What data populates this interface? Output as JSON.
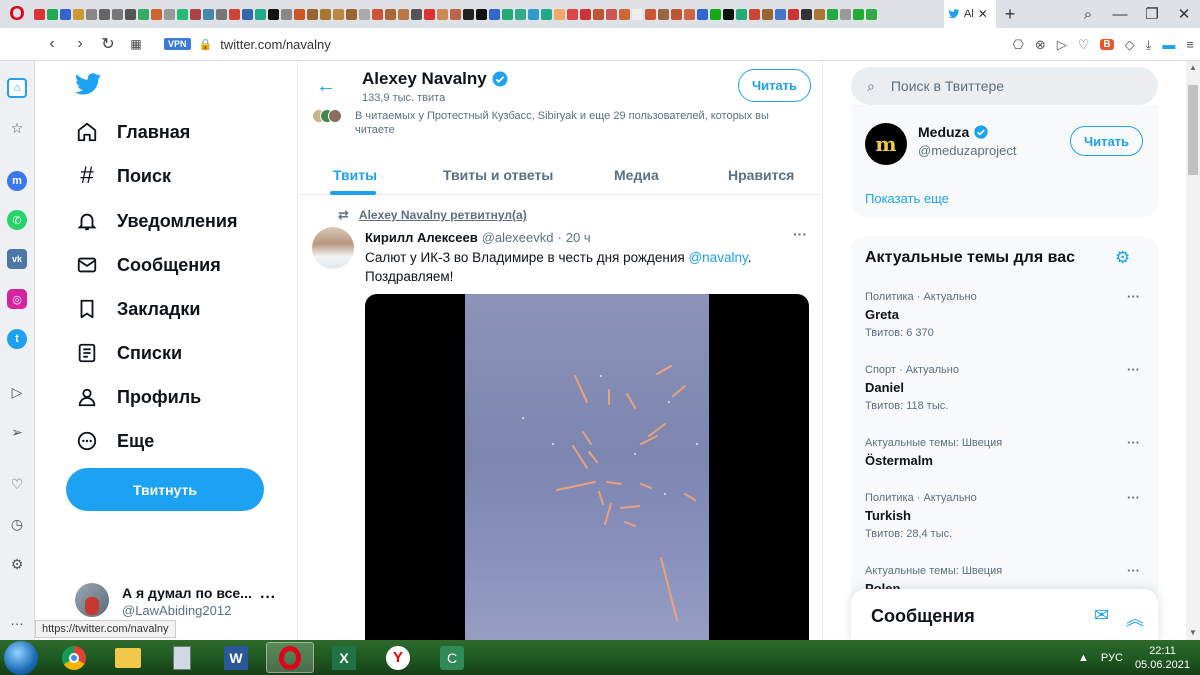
{
  "browser": {
    "active_tab_title": "Al",
    "url": "twitter.com/navalny",
    "vpn_label": "VPN",
    "status_url": "https://twitter.com/navalny"
  },
  "nav": {
    "items": [
      {
        "label": "Главная",
        "icon": "home-icon"
      },
      {
        "label": "Поиск",
        "icon": "hashtag-icon"
      },
      {
        "label": "Уведомления",
        "icon": "bell-icon"
      },
      {
        "label": "Сообщения",
        "icon": "mail-icon"
      },
      {
        "label": "Закладки",
        "icon": "bookmark-icon"
      },
      {
        "label": "Списки",
        "icon": "list-icon"
      },
      {
        "label": "Профиль",
        "icon": "person-icon"
      },
      {
        "label": "Еще",
        "icon": "more-circle-icon"
      }
    ],
    "tweet_button": "Твитнуть",
    "account": {
      "name": "А я думал по все...",
      "handle": "@LawAbiding2012"
    }
  },
  "profile": {
    "name": "Alexey Navalny",
    "tweet_count": "133,9 тыс. твита",
    "follow_label": "Читать",
    "followers_text": "В читаемых у Протестный Кузбасс, Sibiryak и еще 29 пользователей, которых вы читаете",
    "tabs": [
      "Твиты",
      "Твиты и ответы",
      "Медиа",
      "Нравится"
    ]
  },
  "tweet": {
    "retweet_label": "Alexey Navalny ретвитнул(а)",
    "author_name": "Кирилл Алексеев",
    "author_handle": "@alexeevkd",
    "separator": "·",
    "time": "20 ч",
    "text_before": "Салют у ИК-3 во Владимире в честь дня рождения ",
    "mention": "@navalny",
    "text_after": ". Поздравляем!"
  },
  "sidebar": {
    "search_placeholder": "Поиск в Твиттере",
    "suggested": {
      "name": "Meduza",
      "handle": "@meduzaproject",
      "follow_label": "Читать",
      "avatar_letter": "m"
    },
    "show_more": "Показать еще",
    "trends_title": "Актуальные темы для вас",
    "trends": [
      {
        "category": "Политика · Актуально",
        "name": "Greta",
        "count": "Твитов: 6 370"
      },
      {
        "category": "Спорт · Актуально",
        "name": "Daniel",
        "count": "Твитов: 118 тыс."
      },
      {
        "category": "Актуальные темы: Швеция",
        "name": "Östermalm",
        "count": ""
      },
      {
        "category": "Политика · Актуально",
        "name": "Turkish",
        "count": "Твитов: 28,4 тыс."
      },
      {
        "category": "Актуальные темы: Швеция",
        "name": "Polen",
        "count": ""
      }
    ],
    "messages_title": "Сообщения"
  },
  "taskbar": {
    "lang": "РУС",
    "time": "22:11",
    "date": "05.06.2021"
  },
  "colors": {
    "twitter_blue": "#1da1f2",
    "text_primary": "#0f1419",
    "text_secondary": "#5b7083",
    "taskbar_green": "#1f5a23"
  }
}
